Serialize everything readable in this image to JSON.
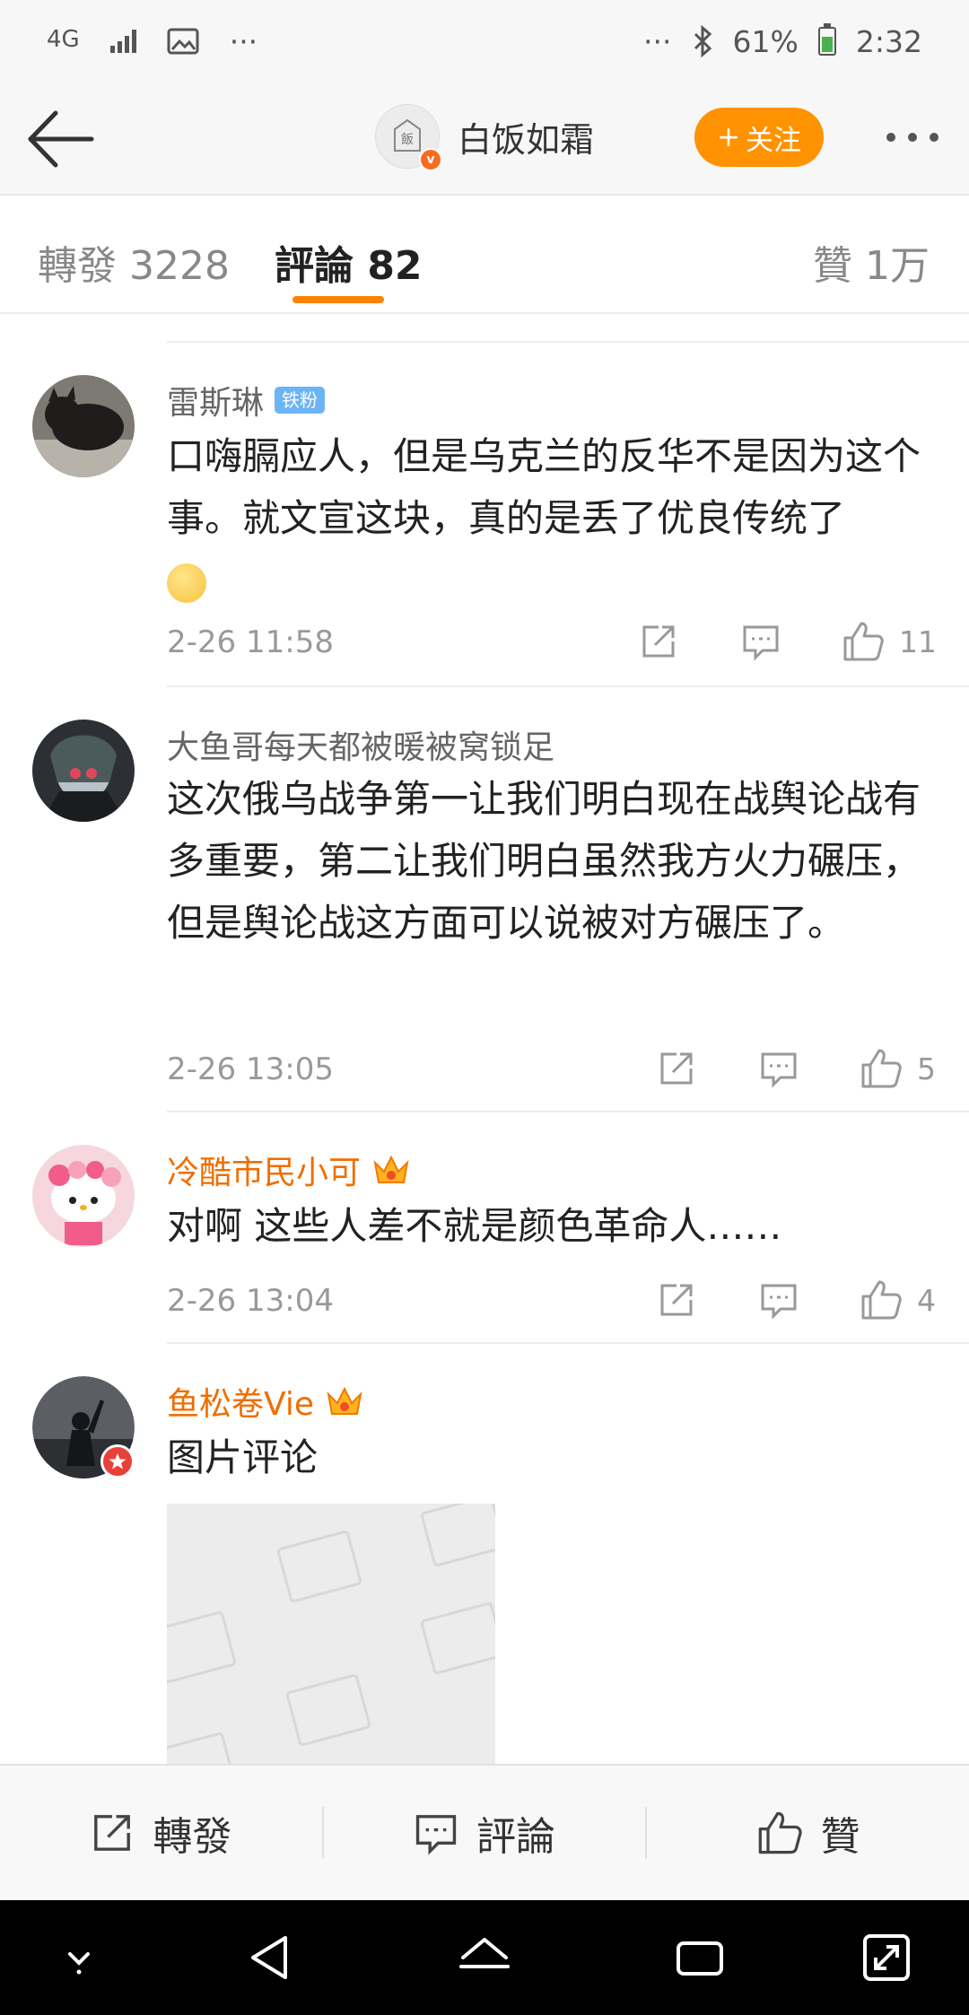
{
  "status_bar": {
    "network": "4G",
    "left_dots": "···",
    "right_dots": "···",
    "battery": "61%",
    "time": "2:32"
  },
  "header": {
    "poster_name": "白饭如霜",
    "avatar_text": "白\n飯",
    "follow_label": "关注",
    "follow_prefix": "+"
  },
  "tabs": {
    "repost": "轉發 3228",
    "comment": "評論 82",
    "like": "贊 1万"
  },
  "comments": [
    {
      "user": "雷斯琳",
      "badge": "铁粉",
      "text": "口嗨膈应人，但是乌克兰的反华不是因为这个事。就文宣这块，真的是丢了优良传统了",
      "time": "2-26 11:58",
      "likes": "11"
    },
    {
      "user": "大鱼哥每天都被暖被窝锁足",
      "text": "这次俄乌战争第一让我们明白现在战舆论战有多重要，第二让我们明白虽然我方火力碾压，但是舆论战这方面可以说被对方碾压了。",
      "time": "2-26 13:05",
      "likes": "5"
    },
    {
      "user": "冷酷市民小可",
      "text": "对啊 这些人差不就是颜色革命人……",
      "time": "2-26 13:04",
      "likes": "4"
    },
    {
      "user": "鱼松卷Vie",
      "text": "图片评论"
    }
  ],
  "toolbar": {
    "repost": "轉發",
    "comment": "評論",
    "like": "贊"
  },
  "colors": {
    "accent": "#ff8200",
    "follow": "#ff9200",
    "vip_name": "#f06e00",
    "fan_badge": "#6bb4f6"
  }
}
